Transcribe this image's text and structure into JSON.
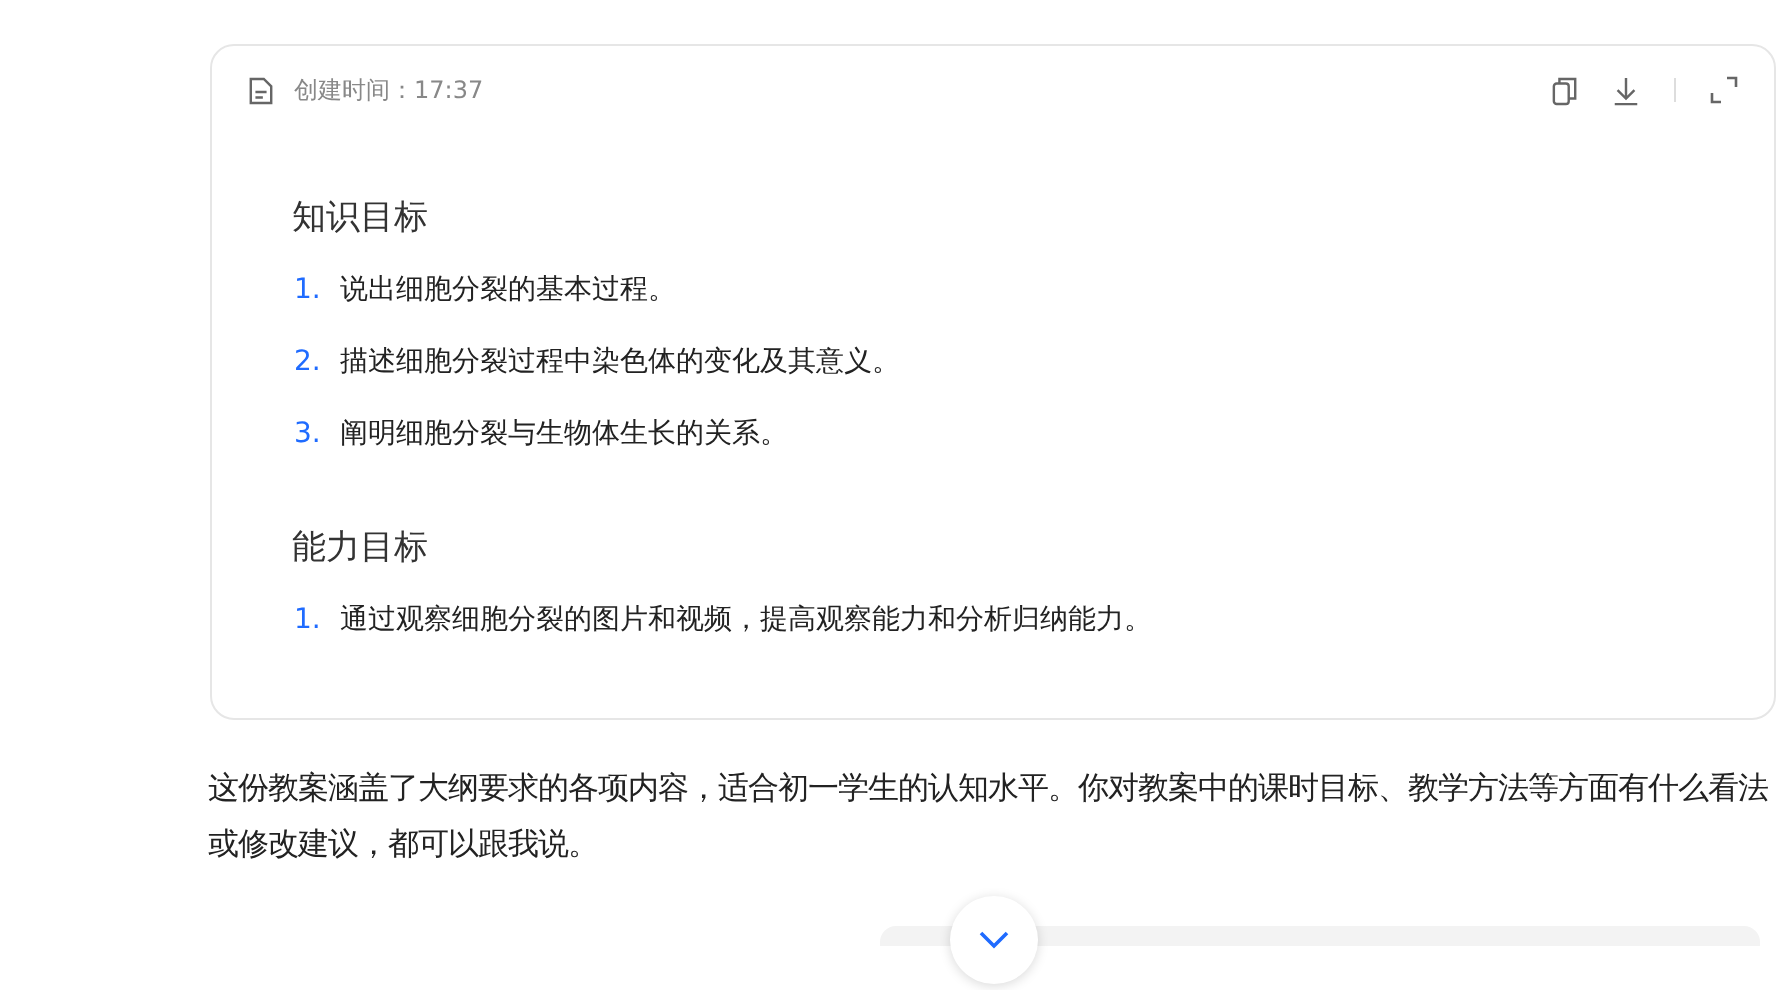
{
  "document_card": {
    "created_label": "创建时间：17:37",
    "sections": [
      {
        "heading": "知识目标",
        "items": [
          {
            "number": "1.",
            "text": "说出细胞分裂的基本过程。"
          },
          {
            "number": "2.",
            "text": "描述细胞分裂过程中染色体的变化及其意义。"
          },
          {
            "number": "3.",
            "text": "阐明细胞分裂与生物体生长的关系。"
          }
        ]
      },
      {
        "heading": "能力目标",
        "items": [
          {
            "number": "1.",
            "text": "通过观察细胞分裂的图片和视频，提高观察能力和分析归纳能力。"
          }
        ]
      }
    ]
  },
  "message": "这份教案涵盖了大纲要求的各项内容，适合初一学生的认知水平。你对教案中的课时目标、教学方法等方面有什么看法或修改建议，都可以跟我说。"
}
